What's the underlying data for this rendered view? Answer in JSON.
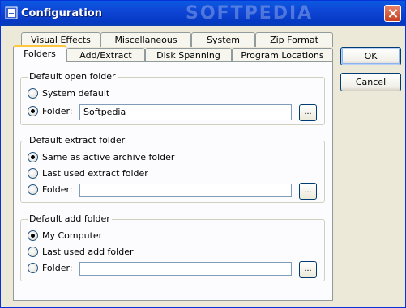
{
  "window": {
    "title": "Configuration",
    "watermark": "SOFTPEDIA"
  },
  "tabs_back": [
    {
      "label": "Visual Effects"
    },
    {
      "label": "Miscellaneous"
    },
    {
      "label": "System"
    },
    {
      "label": "Zip Format"
    }
  ],
  "tabs_front": [
    {
      "label": "Folders",
      "active": true
    },
    {
      "label": "Add/Extract"
    },
    {
      "label": "Disk Spanning"
    },
    {
      "label": "Program Locations"
    }
  ],
  "groups": {
    "open": {
      "title": "Default open folder",
      "opt1": "System default",
      "opt2": "Folder:",
      "path": "Softpedia",
      "selected": "opt2"
    },
    "extract": {
      "title": "Default extract folder",
      "opt1": "Same as active archive folder",
      "opt2": "Last used extract folder",
      "opt3": "Folder:",
      "path": "",
      "selected": "opt1"
    },
    "add": {
      "title": "Default add folder",
      "opt1": "My Computer",
      "opt2": "Last used add folder",
      "opt3": "Folder:",
      "path": "",
      "selected": "opt1"
    }
  },
  "browse_label": "...",
  "buttons": {
    "ok": "OK",
    "cancel": "Cancel"
  },
  "colors": {
    "titlebar": "#0a5ae0",
    "window_bg": "#ece9d8",
    "active_tab_accent": "#ffc83c"
  }
}
